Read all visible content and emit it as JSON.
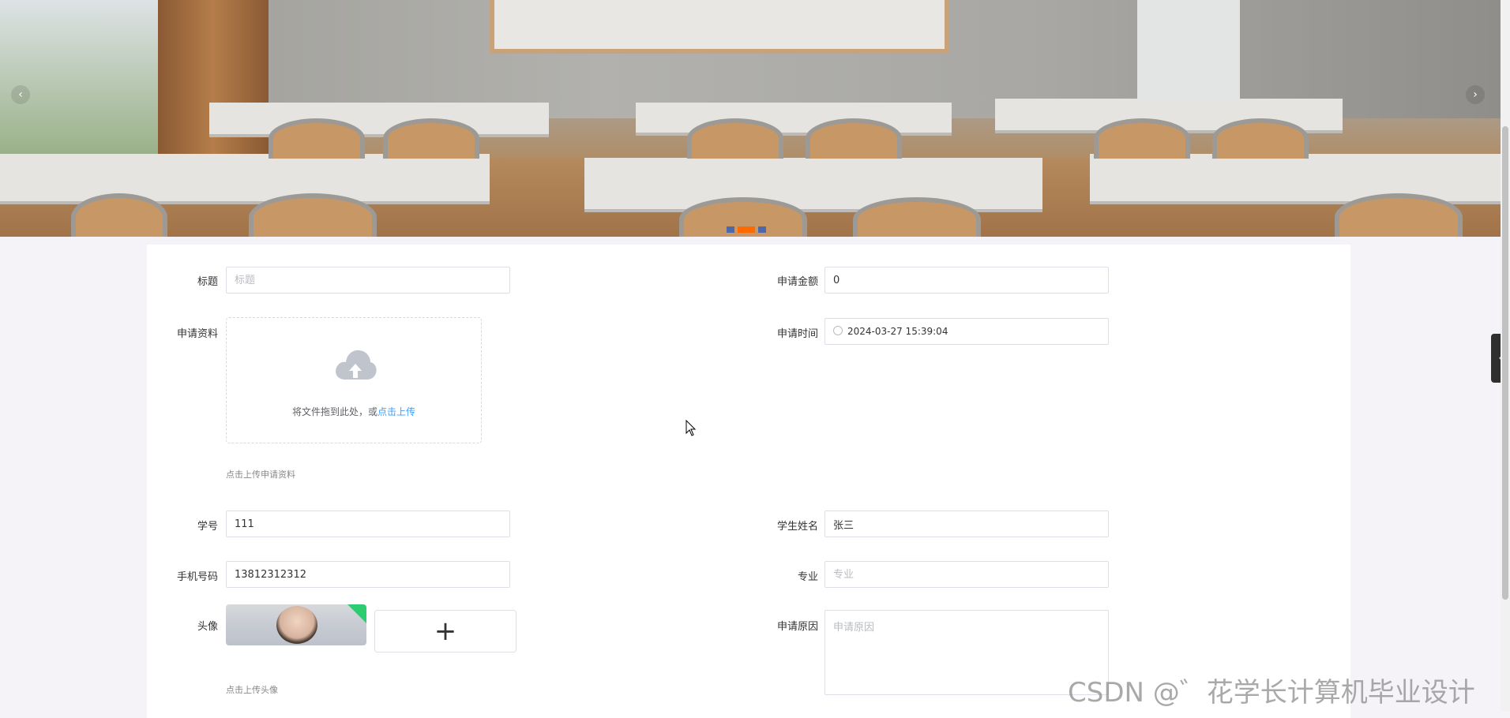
{
  "banner": {
    "prev_icon": "chevron-left-icon",
    "next_icon": "chevron-right-icon",
    "dots": [
      {
        "active": false
      },
      {
        "active": true
      },
      {
        "active": false
      }
    ]
  },
  "form": {
    "title_label": "标题",
    "title_placeholder": "标题",
    "amount_label": "申请金额",
    "amount_value": "0",
    "materials_label": "申请资料",
    "upload_text": "将文件拖到此处，或",
    "upload_link": "点击上传",
    "materials_hint": "点击上传申请资料",
    "time_label": "申请时间",
    "time_value": "2024-03-27 15:39:04",
    "student_no_label": "学号",
    "student_no_value": "111",
    "student_name_label": "学生姓名",
    "student_name_value": "张三",
    "phone_label": "手机号码",
    "phone_value": "13812312312",
    "major_label": "专业",
    "major_placeholder": "专业",
    "avatar_label": "头像",
    "avatar_hint": "点击上传头像",
    "reason_label": "申请原因",
    "reason_placeholder": "申请原因"
  },
  "watermark": "CSDN @゛花学长计算机毕业设计"
}
